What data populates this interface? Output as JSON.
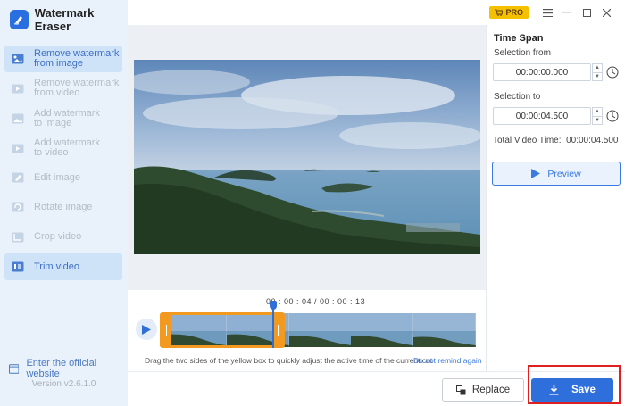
{
  "app": {
    "title": "Watermark Eraser",
    "version": "Version v2.6.1.0",
    "website_link": "Enter the official website"
  },
  "titlebar": {
    "pro_label": "PRO"
  },
  "sidebar": {
    "items": [
      {
        "label": "Remove watermark\nfrom image",
        "icon": "image-eraser-icon",
        "active": true
      },
      {
        "label": "Remove watermark\nfrom video",
        "icon": "video-eraser-icon",
        "active": false
      },
      {
        "label": "Add watermark\nto image",
        "icon": "image-add-icon",
        "active": false
      },
      {
        "label": "Add watermark\nto video",
        "icon": "video-add-icon",
        "active": false
      },
      {
        "label": "Edit image",
        "icon": "edit-image-icon",
        "active": false
      },
      {
        "label": "Rotate image",
        "icon": "rotate-image-icon",
        "active": false
      },
      {
        "label": "Crop video",
        "icon": "crop-video-icon",
        "active": false
      },
      {
        "label": "Trim video",
        "icon": "trim-video-icon",
        "active": true
      }
    ]
  },
  "time_span": {
    "title": "Time Span",
    "selection_from_label": "Selection from",
    "selection_from_value": "00:00:00.000",
    "selection_to_label": "Selection to",
    "selection_to_value": "00:00:04.500",
    "total_label": "Total Video Time:",
    "total_value": "00:00:04.500",
    "preview_label": "Preview"
  },
  "timeline": {
    "timecode": "00 : 00 : 04 / 00 : 00 : 13",
    "hint": "Drag the two sides of the yellow box to quickly adjust the active time of the current cut",
    "hint_link": "Do not remind again",
    "playhead_seconds": 4,
    "duration_seconds": 13
  },
  "actions": {
    "replace_label": "Replace",
    "save_label": "Save"
  },
  "colors": {
    "accent": "#2f6fdc",
    "selection": "#f29a1f",
    "highlight": "#e02020",
    "sidebar_bg": "#e9f2fb"
  }
}
